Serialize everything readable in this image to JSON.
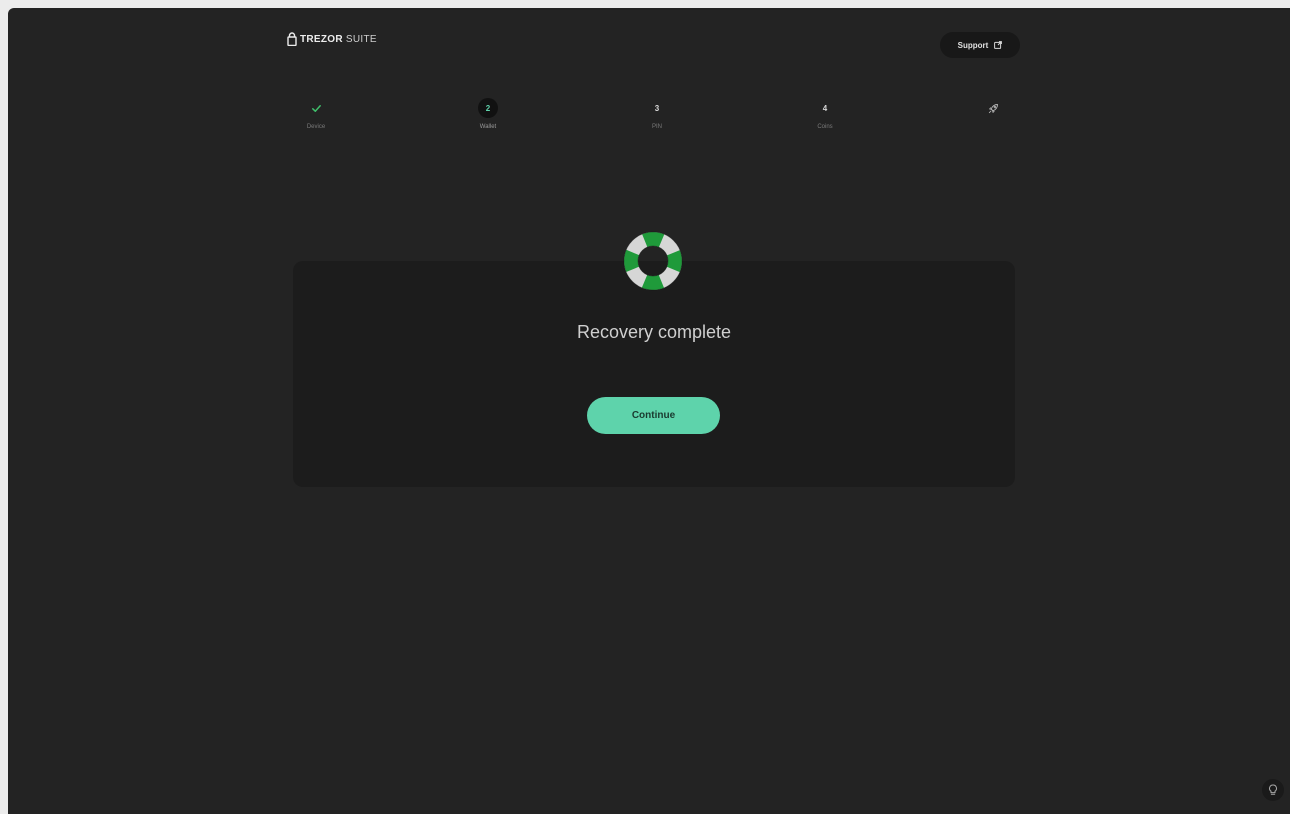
{
  "header": {
    "brand_name": "TREZOR",
    "brand_suffix": "SUITE",
    "support_label": "Support"
  },
  "stepper": {
    "steps": [
      {
        "marker": "✓",
        "label": "Device",
        "state": "completed"
      },
      {
        "marker": "2",
        "label": "Wallet",
        "state": "active"
      },
      {
        "marker": "3",
        "label": "PIN",
        "state": "pending"
      },
      {
        "marker": "4",
        "label": "Coins",
        "state": "pending"
      },
      {
        "marker": "rocket-icon",
        "label": "",
        "state": "pending"
      }
    ]
  },
  "main": {
    "title": "Recovery complete",
    "continue_label": "Continue",
    "icon": "lifebuoy-icon"
  },
  "colors": {
    "background": "#232323",
    "card": "#1c1c1c",
    "accent": "#5ed3ab",
    "lifebuoy_green": "#1f9a3a",
    "lifebuoy_white": "#d6d6d6"
  }
}
